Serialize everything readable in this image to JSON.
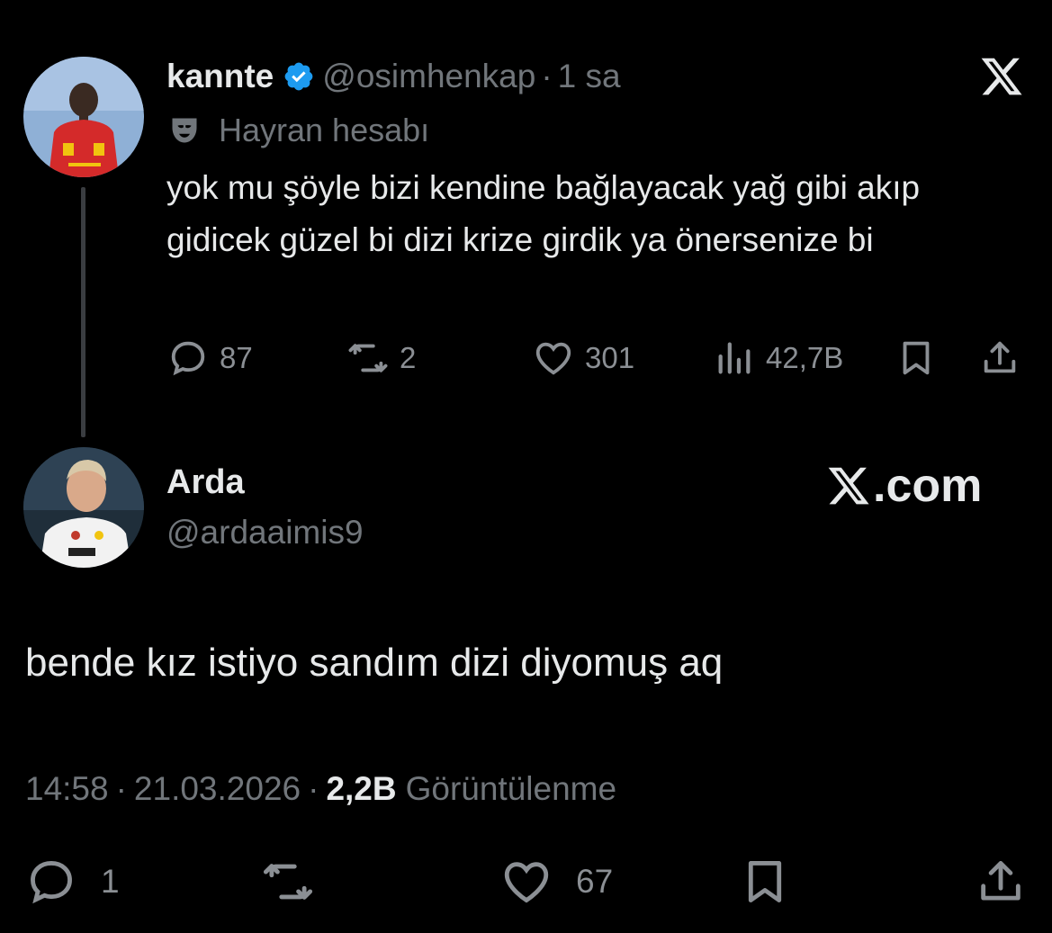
{
  "parent": {
    "display_name": "kannte",
    "handle": "@osimhenkap",
    "separator": "·",
    "time_ago": "1 sa",
    "badge_label": "Hayran hesabı",
    "text": "yok mu şöyle bizi kendine bağlayacak yağ gibi akıp gidicek güzel bi dizi krize girdik ya önersenize bi",
    "metrics": {
      "replies": "87",
      "reposts": "2",
      "likes": "301",
      "views": "42,7B"
    }
  },
  "reply": {
    "display_name": "Arda",
    "handle": "@ardaaimis9",
    "watermark": ".com",
    "text": "bende kız istiyo sandım dizi diyomuş aq",
    "time": "14:58",
    "date": "21.03.2026",
    "views_count": "2,2B",
    "views_label": "Görüntülenme",
    "separator": "·",
    "metrics": {
      "replies": "1",
      "likes": "67"
    }
  },
  "icons": {
    "verified": "verified-badge-icon",
    "fan_account": "mask-icon",
    "close": "x-logo-icon",
    "reply": "reply-bubble-icon",
    "repost": "repost-icon",
    "like": "heart-icon",
    "views": "views-chart-icon",
    "bookmark": "bookmark-icon",
    "share": "share-icon"
  },
  "colors": {
    "background": "#000000",
    "text": "#e7e9ea",
    "muted": "#71767b",
    "verified": "#1d9bf0"
  }
}
